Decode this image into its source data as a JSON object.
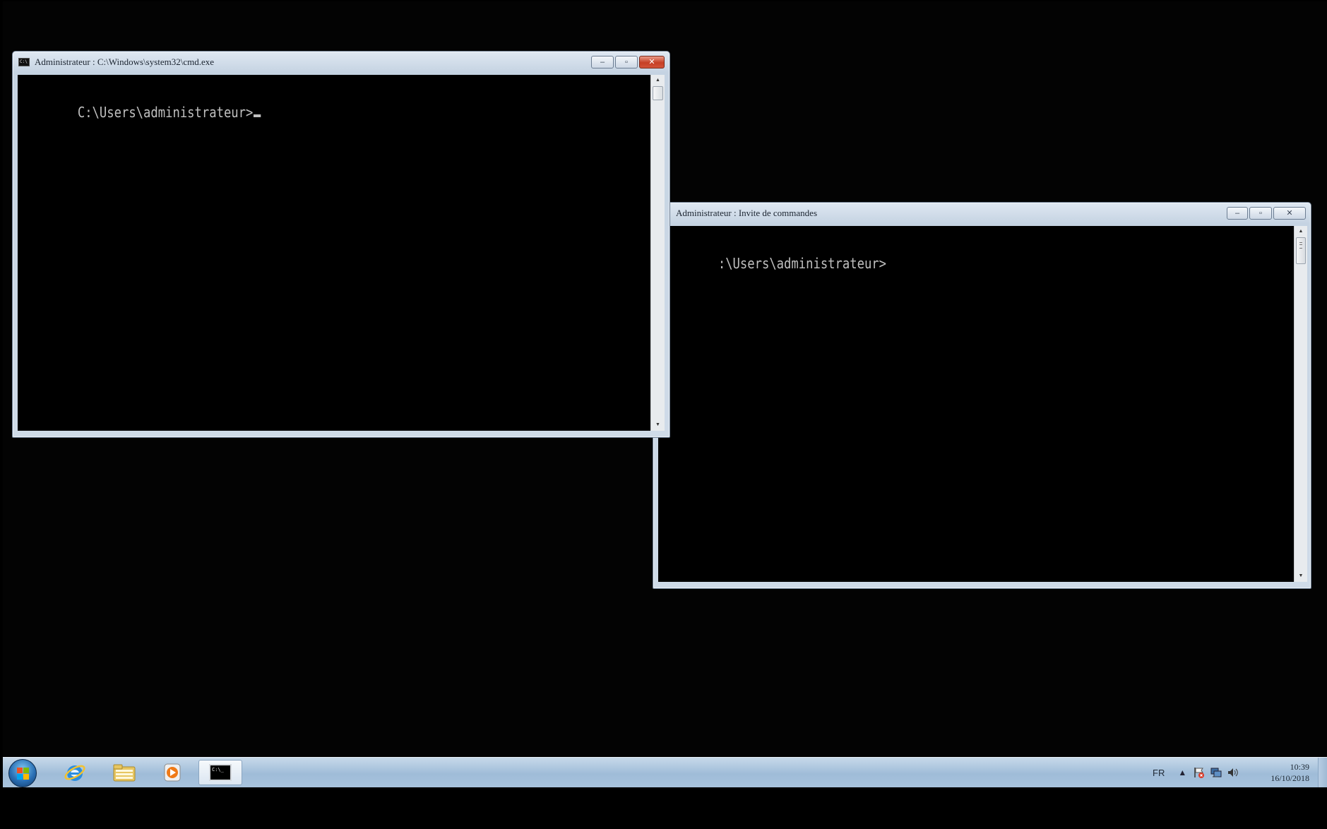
{
  "window1": {
    "title": "Administrateur : C:\\Windows\\system32\\cmd.exe",
    "icon_text": "C:\\",
    "prompt": "C:\\Users\\administrateur>",
    "active": true
  },
  "window2": {
    "title": "Administrateur : Invite de commandes",
    "prompt": ":\\Users\\administrateur>",
    "active": false
  },
  "window_controls": {
    "minimize": "–",
    "maximize": "▫",
    "close": "✕"
  },
  "taskbar": {
    "pinned": [
      {
        "name": "Internet Explorer",
        "icon": "ie-icon"
      },
      {
        "name": "Explorateur Windows",
        "icon": "folder-icon"
      },
      {
        "name": "Lecteur Windows Media",
        "icon": "media-player-icon"
      },
      {
        "name": "Invite de commandes",
        "icon": "cmd-icon",
        "active": true
      }
    ],
    "cmd_icon_text": "C:\\_",
    "tray": {
      "language": "FR",
      "clock_time": "10:39",
      "clock_date": "16/10/2018"
    }
  },
  "colors": {
    "console_bg": "#000000",
    "console_text": "#c0c0c0",
    "taskbar": "#a8c3dd",
    "close_button": "#c63f25"
  }
}
